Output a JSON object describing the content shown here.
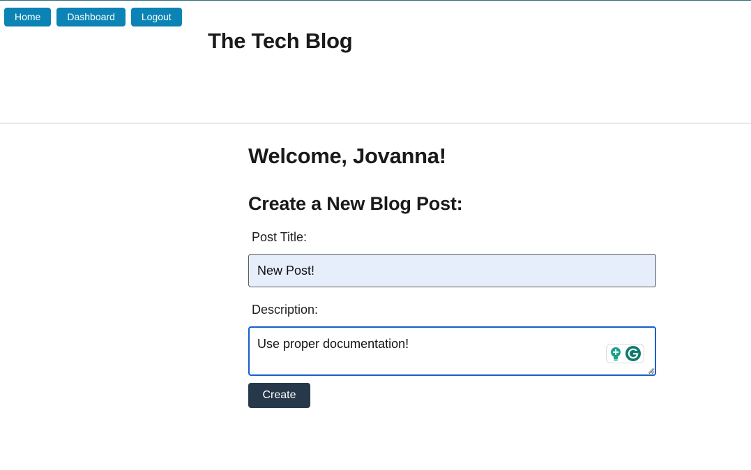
{
  "nav": {
    "home_label": "Home",
    "dashboard_label": "Dashboard",
    "logout_label": "Logout"
  },
  "header": {
    "site_title": "The Tech Blog"
  },
  "main": {
    "welcome": "Welcome, Jovanna!",
    "form_heading": "Create a New Blog Post:",
    "title_label": "Post Title:",
    "title_value": "New Post!",
    "description_label": "Description:",
    "description_value": "Use proper documentation!",
    "create_label": "Create"
  },
  "icons": {
    "grammarly_suggestion": "lightbulb-icon",
    "grammarly_logo": "grammarly-icon"
  },
  "colors": {
    "nav_button": "#0b84b5",
    "create_button": "#27384a",
    "focus_border": "#1560c9",
    "autofill_background": "#e6eefb",
    "grammarly_green": "#15a38b"
  }
}
